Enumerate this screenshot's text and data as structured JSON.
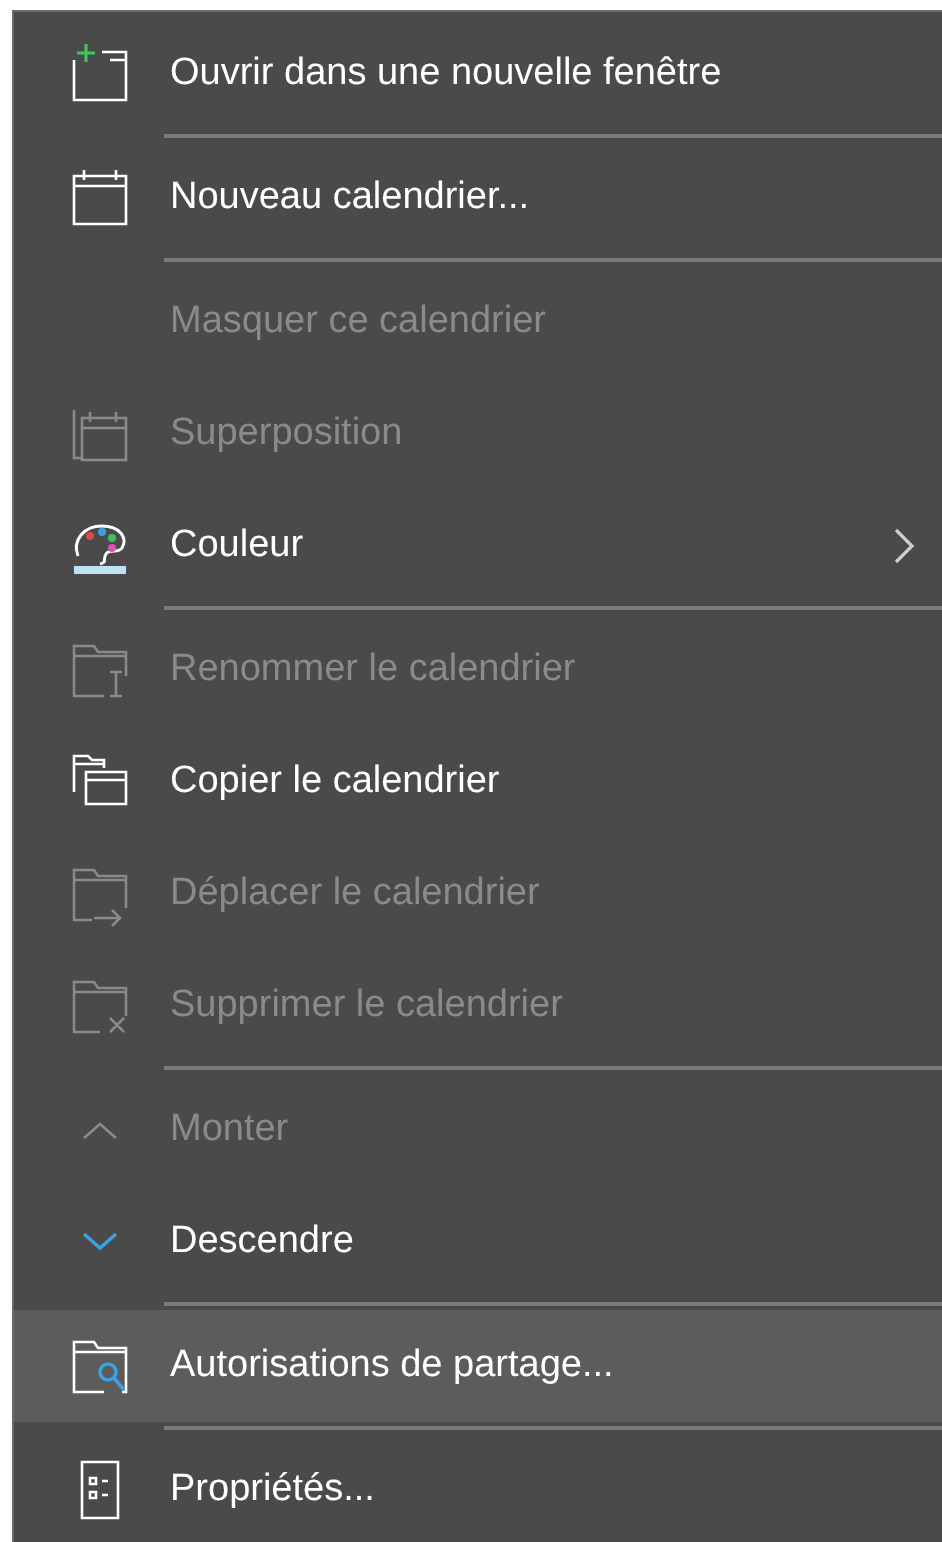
{
  "menu": {
    "items": [
      {
        "kind": "item",
        "label": "Ouvrir dans une nouvelle fenêtre",
        "disabled": false,
        "selected": false
      },
      {
        "kind": "separator"
      },
      {
        "kind": "item",
        "label": "Nouveau calendrier...",
        "disabled": false,
        "selected": false
      },
      {
        "kind": "separator"
      },
      {
        "kind": "item",
        "label": "Masquer ce calendrier",
        "disabled": true,
        "selected": false
      },
      {
        "kind": "item",
        "label": "Superposition",
        "disabled": true,
        "selected": false
      },
      {
        "kind": "item",
        "label": "Couleur",
        "disabled": false,
        "selected": false,
        "submenu": true
      },
      {
        "kind": "separator"
      },
      {
        "kind": "item",
        "label": "Renommer le calendrier",
        "disabled": true,
        "selected": false
      },
      {
        "kind": "item",
        "label": "Copier le calendrier",
        "disabled": false,
        "selected": false
      },
      {
        "kind": "item",
        "label": "Déplacer le calendrier",
        "disabled": true,
        "selected": false
      },
      {
        "kind": "item",
        "label": "Supprimer le calendrier",
        "disabled": true,
        "selected": false
      },
      {
        "kind": "separator"
      },
      {
        "kind": "item",
        "label": "Monter",
        "disabled": true,
        "selected": false
      },
      {
        "kind": "item",
        "label": "Descendre",
        "disabled": false,
        "selected": false
      },
      {
        "kind": "separator"
      },
      {
        "kind": "item",
        "label": "Autorisations de partage...",
        "disabled": false,
        "selected": true
      },
      {
        "kind": "separator"
      },
      {
        "kind": "item",
        "label": "Propriétés...",
        "disabled": false,
        "selected": false
      }
    ]
  }
}
